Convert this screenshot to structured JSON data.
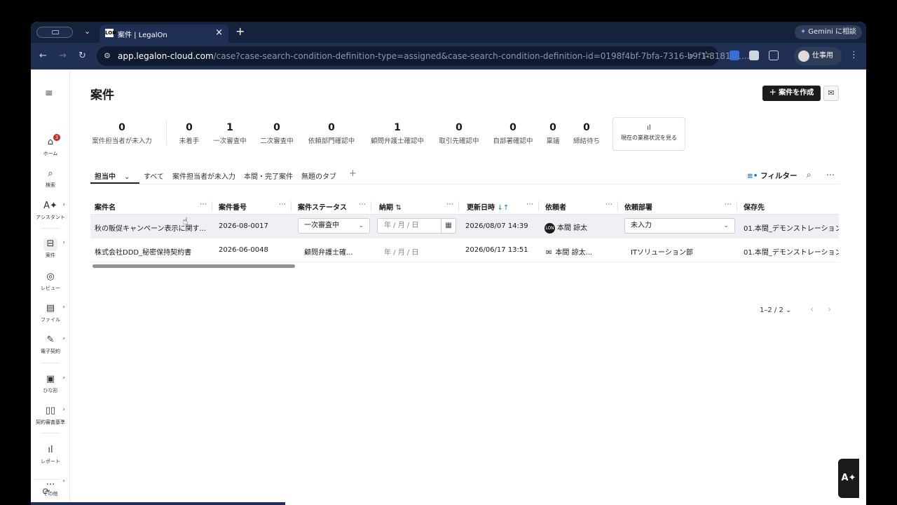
{
  "browser": {
    "tab_title": "案件 | LegalOn",
    "tab_favicon": "LON",
    "gemini_label": "Gemini に相談",
    "url_host": "app.legalon-cloud.com",
    "url_path": "/case?case-search-condition-definition-type=assigned&case-search-condition-definition-id=0198f4bf-7bfa-7316-b9f1-818151...",
    "profile_label": "仕事用"
  },
  "sidebar": {
    "home_badge": "3",
    "items": [
      {
        "label": "ホーム",
        "icon": "home-icon"
      },
      {
        "label": "検索",
        "icon": "search-icon"
      },
      {
        "label": "アシスタント",
        "icon": "assistant-icon"
      },
      {
        "label": "案件",
        "icon": "inbox-icon"
      },
      {
        "label": "レビュー",
        "icon": "check-circle-icon"
      },
      {
        "label": "ファイル",
        "icon": "file-icon"
      },
      {
        "label": "電子契約",
        "icon": "pen-icon"
      },
      {
        "label": "ひな形",
        "icon": "template-icon"
      },
      {
        "label": "契約審査基準",
        "icon": "book-icon"
      },
      {
        "label": "レポート",
        "icon": "bar-chart-icon"
      },
      {
        "label": "その他",
        "icon": "more-icon"
      }
    ]
  },
  "header": {
    "title": "案件",
    "create_label": "＋ 案件を作成"
  },
  "stats": [
    {
      "num": "0",
      "label": "案件担当者が未入力"
    },
    {
      "num": "0",
      "label": "未着手"
    },
    {
      "num": "1",
      "label": "一次審査中"
    },
    {
      "num": "0",
      "label": "二次審査中"
    },
    {
      "num": "0",
      "label": "依頼部門確認中"
    },
    {
      "num": "1",
      "label": "顧問弁護士確認中"
    },
    {
      "num": "0",
      "label": "取引先確認中"
    },
    {
      "num": "0",
      "label": "自部署確認中"
    },
    {
      "num": "0",
      "label": "稟議"
    },
    {
      "num": "0",
      "label": "締結待ち"
    }
  ],
  "status_button_label": "現在の業務状況を見る",
  "tabs": [
    "担当中",
    "すべて",
    "案件担当者が未入力",
    "本間・完了案件",
    "無題のタブ"
  ],
  "filter_label": "フィルター",
  "table": {
    "columns": [
      "案件名",
      "案件番号",
      "案件ステータス",
      "納期",
      "更新日時",
      "依頼者",
      "依頼部署",
      "保存先"
    ],
    "rows": [
      {
        "name": "秋の販促キャンペーン表示に関す...",
        "number": "2026-08-0017",
        "status": "一次審査中",
        "due": "年 / 月 / 日",
        "updated": "2026/08/07 14:39",
        "requester": "本間 諒太",
        "requester_avatar": "LON",
        "department": "未入力",
        "storage": "01.本間_デモンストレーション"
      },
      {
        "name": "株式会社DDD_秘密保持契約書",
        "number": "2026-06-0048",
        "status": "顧問弁護士確...",
        "due": "年 / 月 / 日",
        "updated": "2026/06/17 13:51",
        "requester": "本間 諒太...",
        "department": "ITソリューション部",
        "storage": "01.本間_デモンストレーション"
      }
    ]
  },
  "pagination": {
    "label": "1–2 / 2"
  },
  "accent_color": "#1a73e8"
}
